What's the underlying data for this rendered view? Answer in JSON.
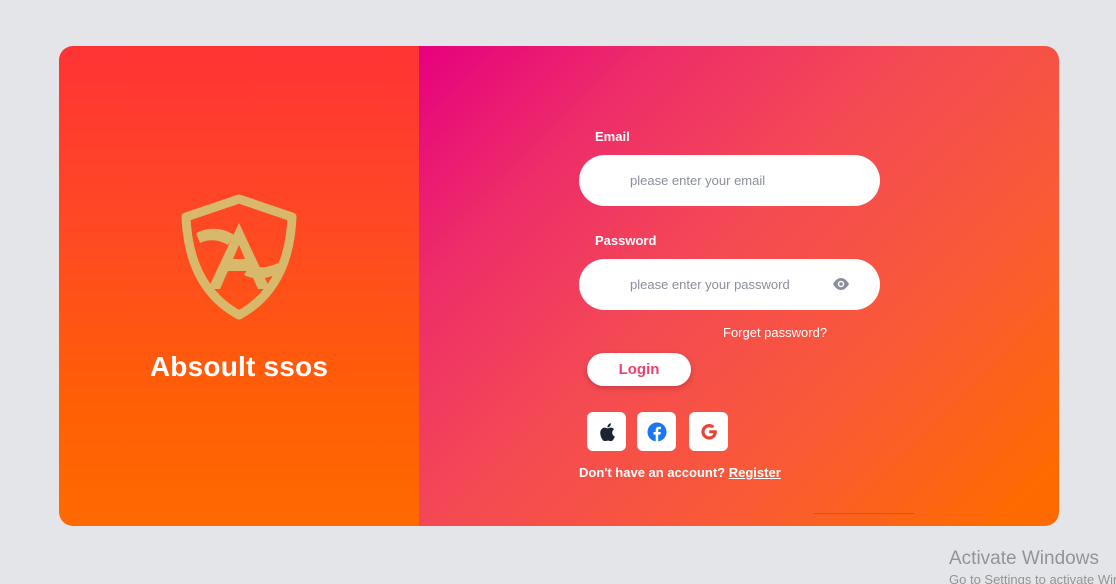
{
  "brand": {
    "name": "Absoult ssos",
    "logo_icon": "shield-a-logo",
    "logo_color": "#d8b86a"
  },
  "form": {
    "email": {
      "label": "Email",
      "value": "",
      "placeholder": "please enter your email"
    },
    "password": {
      "label": "Password",
      "value": "",
      "placeholder": "please enter your password",
      "toggle_icon": "eye-icon"
    },
    "forget_label": "Forget password?",
    "login_label": "Login"
  },
  "social": {
    "items": [
      {
        "icon": "apple-icon"
      },
      {
        "icon": "facebook-icon",
        "color": "#1877f2"
      },
      {
        "icon": "google-icon",
        "color": "#ea4335"
      }
    ]
  },
  "register": {
    "prompt": "Don't have an account?",
    "link_label": "Register"
  },
  "system": {
    "watermark_title": "Activate Windows",
    "watermark_sub": "Go to Settings to activate Windows."
  },
  "colors": {
    "left_gradient": [
      "#ff3335",
      "#ff6a00"
    ],
    "right_gradient": [
      "#e6007e",
      "#ff6a00"
    ],
    "login_text": "#ef3f6a"
  }
}
